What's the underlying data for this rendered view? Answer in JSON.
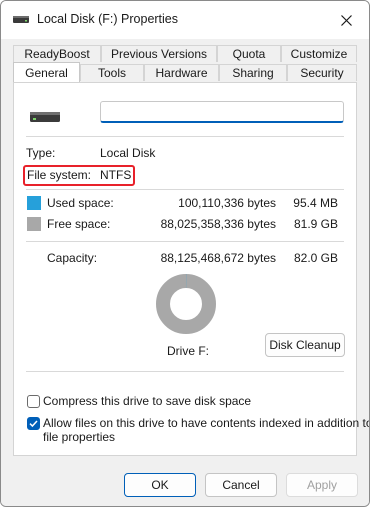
{
  "window": {
    "title": "Local Disk (F:) Properties",
    "accent_color": "#005fb8",
    "highlight_color": "#e8212a"
  },
  "tabs": {
    "row1": [
      "ReadyBoost",
      "Previous Versions",
      "Quota",
      "Customize"
    ],
    "row2": [
      "General",
      "Tools",
      "Hardware",
      "Sharing",
      "Security"
    ],
    "active": "General"
  },
  "general": {
    "name_value": "",
    "type_label": "Type:",
    "type_value": "Local Disk",
    "fs_label": "File system:",
    "fs_value": "NTFS",
    "used_label": "Used space:",
    "used_bytes": "100,110,336 bytes",
    "used_human": "95.4 MB",
    "used_color": "#26a0da",
    "free_label": "Free space:",
    "free_bytes": "88,025,358,336 bytes",
    "free_human": "81.9 GB",
    "free_color": "#a8a8a8",
    "capacity_label": "Capacity:",
    "capacity_bytes": "88,125,468,672 bytes",
    "capacity_human": "82.0 GB",
    "used_fraction": 0.0011,
    "drive_label": "Drive F:",
    "cleanup_label": "Disk Cleanup",
    "compress_label": "Compress this drive to save disk space",
    "compress_checked": false,
    "index_label_line1": "Allow files on this drive to have contents indexed in addition to",
    "index_label_line2": "file properties",
    "index_checked": true
  },
  "footer": {
    "ok": "OK",
    "cancel": "Cancel",
    "apply": "Apply"
  },
  "icons": {
    "title": "drive-icon",
    "close": "close-icon",
    "drive": "hard-drive-icon",
    "check": "checkmark-icon"
  }
}
